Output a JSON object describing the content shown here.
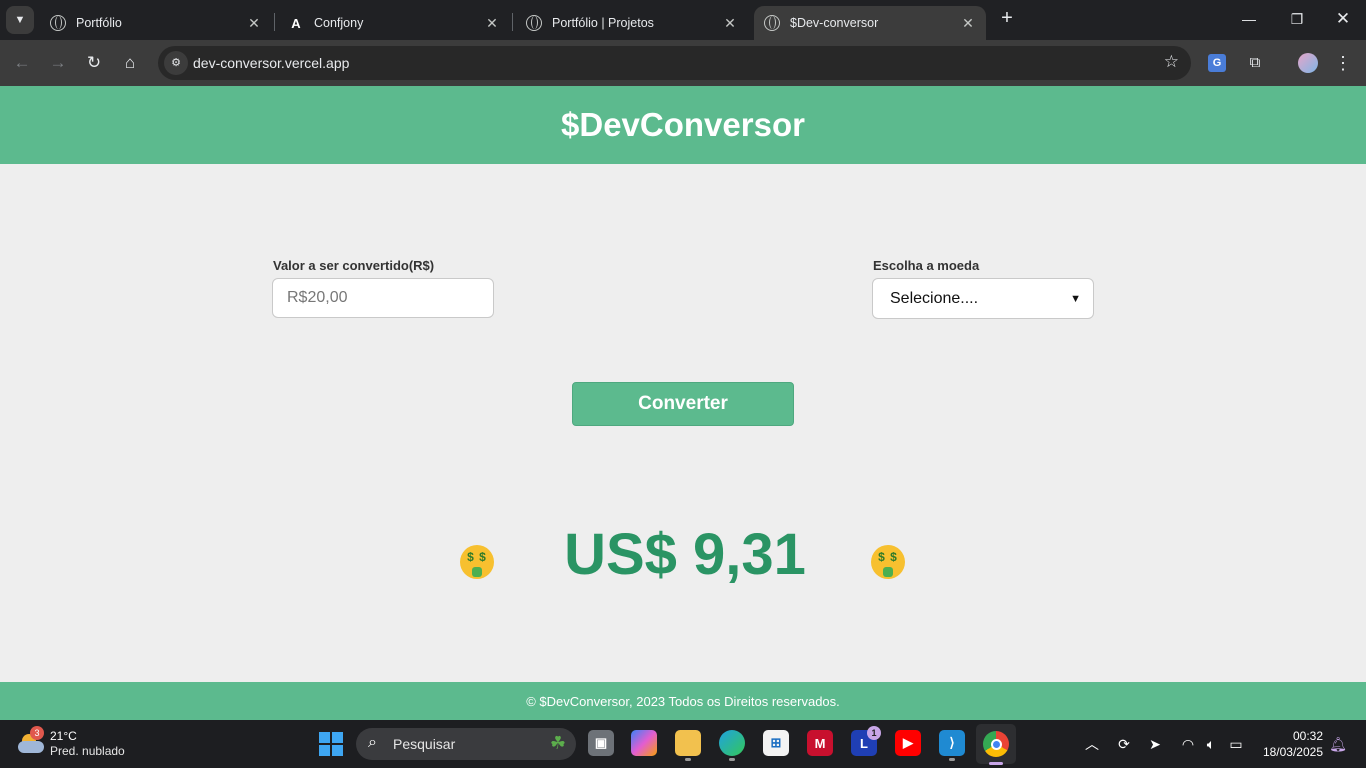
{
  "browser": {
    "tabs": [
      {
        "title": "Portfólio",
        "favicon": "globe-icon"
      },
      {
        "title": "Confjony",
        "favicon": "angular-a-icon"
      },
      {
        "title": "Portfólio | Projetos",
        "favicon": "globe-icon"
      },
      {
        "title": "$Dev-conversor",
        "favicon": "globe-icon",
        "active": true
      }
    ],
    "url": "dev-conversor.vercel.app"
  },
  "site": {
    "title": "$DevConversor",
    "amount_label": "Valor a ser convertido(R$)",
    "amount_placeholder": "R$20,00",
    "currency_label": "Escolha a moeda",
    "currency_selected": "Selecione....",
    "convert_label": "Converter",
    "result": "US$ 9,31",
    "footer": "© $DevConversor, 2023 Todos os Direitos reservados.",
    "colors": {
      "brand": "#5cba8e",
      "result": "#2a9464",
      "background": "#eeeeee"
    }
  },
  "taskbar": {
    "weather_temp": "21°C",
    "weather_desc": "Pred. nublado",
    "weather_badge": "3",
    "search_placeholder": "Pesquisar",
    "app_badge": "1",
    "time": "00:32",
    "date": "18/03/2025"
  }
}
